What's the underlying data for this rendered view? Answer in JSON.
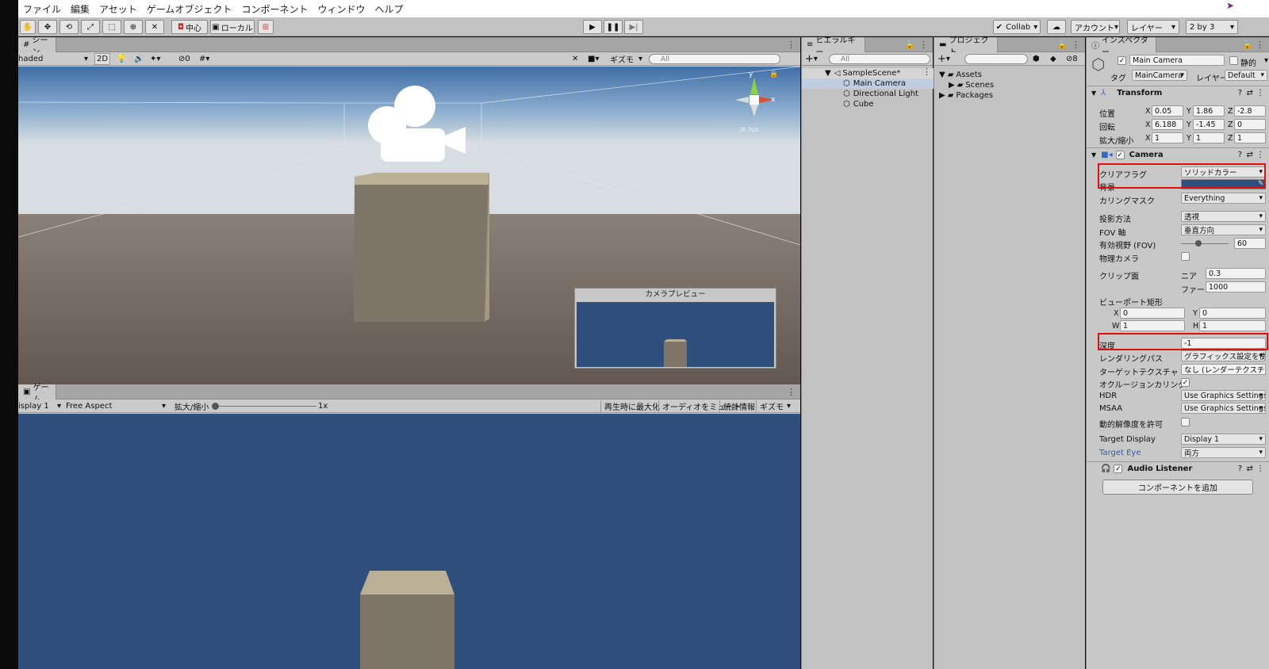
{
  "menu": [
    "ファイル",
    "編集",
    "アセット",
    "ゲームオブジェクト",
    "コンポーネント",
    "ウィンドウ",
    "ヘルプ"
  ],
  "toolbar": {
    "pivot": "中心",
    "space": "ローカル",
    "collab": "Collab",
    "account": "アカウント",
    "layers": "レイヤー",
    "layout": "2 by 3"
  },
  "scene": {
    "tab": "シーン",
    "shading": "haded",
    "mode_2d": "2D",
    "hidden_count": "0",
    "gizmos": "ギズモ",
    "search_placeholder": "All",
    "gizmo_y": "y",
    "gizmo_x": "x",
    "persp": "Iso",
    "camera_preview_title": "カメラプレビュー"
  },
  "game": {
    "tab": "ゲーム",
    "display": "isplay 1",
    "aspect": "Free Aspect",
    "scale_label": "拡大/縮小",
    "scale_value": "1x",
    "maximize": "再生時に最大化",
    "mute": "オーディオをミュート",
    "stats": "統計情報",
    "gizmos": "ギズモ"
  },
  "hierarchy": {
    "tab": "ヒエラルキー",
    "search_placeholder": "All",
    "scene": "SampleScene*",
    "items": [
      "Main Camera",
      "Directional Light",
      "Cube"
    ]
  },
  "project": {
    "tab": "プロジェクト",
    "count": "8",
    "folders": [
      "Assets",
      "Scenes",
      "Packages"
    ]
  },
  "inspector": {
    "tab": "インスペクター",
    "object_name": "Main Camera",
    "static_label": "静的",
    "tag_label": "タグ",
    "tag_value": "MainCamera",
    "layer_label": "レイヤー",
    "layer_value": "Default",
    "transform": {
      "title": "Transform",
      "position_label": "位置",
      "rotation_label": "回転",
      "scale_label": "拡大/縮小",
      "position": [
        "0.05",
        "1.86",
        "-2.8"
      ],
      "rotation": [
        "6.188",
        "-1.45",
        "0"
      ],
      "scale": [
        "1",
        "1",
        "1"
      ]
    },
    "camera": {
      "title": "Camera",
      "clear_flags_label": "クリアフラグ",
      "clear_flags_value": "ソリッドカラー",
      "background_label": "背景",
      "culling_mask_label": "カリングマスク",
      "culling_mask_value": "Everything",
      "projection_label": "投影方法",
      "projection_value": "透視",
      "fov_axis_label": "FOV 軸",
      "fov_axis_value": "垂直方向",
      "fov_label": "有効視野 (FOV)",
      "fov_value": "60",
      "physical_label": "物理カメラ",
      "clipping_label": "クリップ面",
      "near_label": "ニア",
      "near_value": "0.3",
      "far_label": "ファー",
      "far_value": "1000",
      "viewport_label": "ビューポート矩形",
      "vp_x": "0",
      "vp_y": "0",
      "vp_w": "1",
      "vp_h": "1",
      "depth_label": "深度",
      "depth_value": "-1",
      "render_path_label": "レンダリングパス",
      "render_path_value": "グラフィックス設定を使用",
      "target_texture_label": "ターゲットテクスチャ",
      "target_texture_value": "なし (レンダーテクスチャ)",
      "occlusion_label": "オクルージョンカリング",
      "hdr_label": "HDR",
      "hdr_value": "Use Graphics Settings",
      "msaa_label": "MSAA",
      "msaa_value": "Use Graphics Settings",
      "dynamic_res_label": "動的解像度を許可",
      "target_display_label": "Target Display",
      "target_display_value": "Display 1",
      "target_eye_label": "Target Eye",
      "target_eye_value": "両方"
    },
    "audio_listener": "Audio Listener",
    "add_component": "コンポーネントを追加"
  },
  "colors": {
    "camera_bg": "#2f4f7d",
    "highlight": "#e01010",
    "selection": "#c0cde0"
  }
}
